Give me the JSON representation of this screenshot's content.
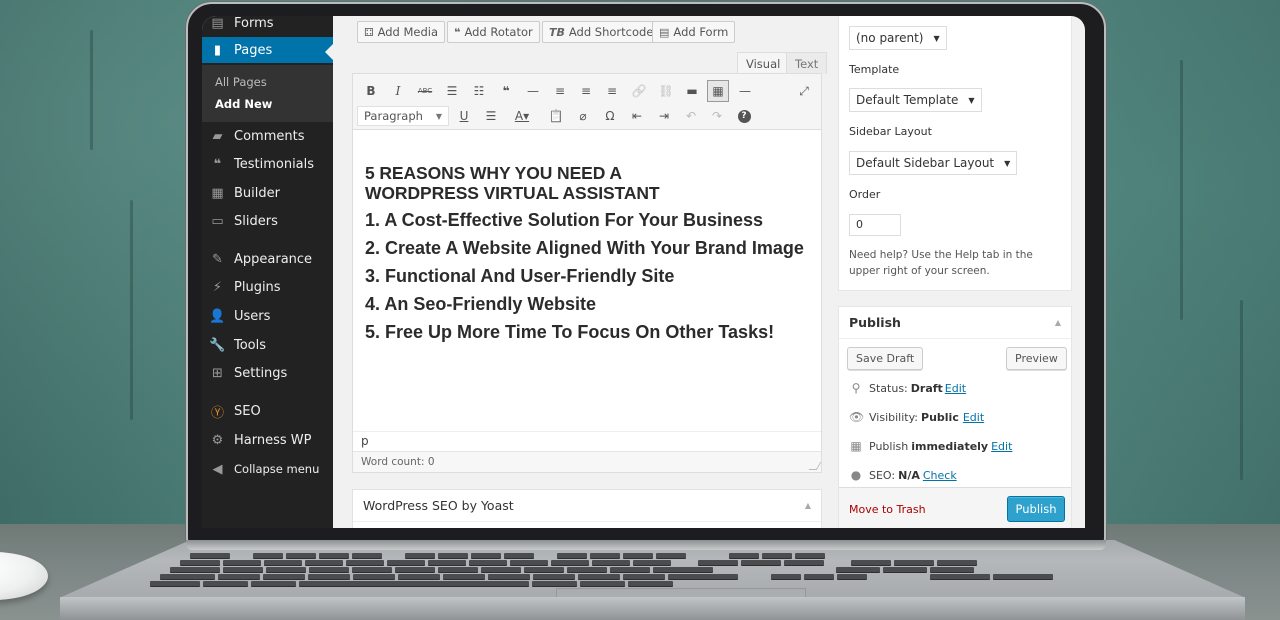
{
  "sidebar": {
    "items": [
      {
        "label": "Forms",
        "icon": "forms-icon"
      },
      {
        "label": "Pages",
        "icon": "pages-icon",
        "active": true
      },
      {
        "label": "Comments",
        "icon": "comments-icon"
      },
      {
        "label": "Testimonials",
        "icon": "quote-icon"
      },
      {
        "label": "Builder",
        "icon": "builder-icon"
      },
      {
        "label": "Sliders",
        "icon": "sliders-icon"
      },
      {
        "label": "Appearance",
        "icon": "paintbrush-icon"
      },
      {
        "label": "Plugins",
        "icon": "plug-icon"
      },
      {
        "label": "Users",
        "icon": "user-icon"
      },
      {
        "label": "Tools",
        "icon": "wrench-icon"
      },
      {
        "label": "Settings",
        "icon": "settings-icon"
      },
      {
        "label": "SEO",
        "icon": "yoast-icon"
      },
      {
        "label": "Harness WP",
        "icon": "gear-icon"
      }
    ],
    "submenu": [
      {
        "label": "All Pages"
      },
      {
        "label": "Add New",
        "current": true
      }
    ],
    "collapse_label": "Collapse menu"
  },
  "editor": {
    "media_buttons": [
      {
        "label": "Add Media",
        "icon": "add-media-icon",
        "glyph": "⚃"
      },
      {
        "label": "Add Rotator",
        "icon": "quote-icon",
        "glyph": "❝"
      },
      {
        "label": "Add Shortcode",
        "icon": "shortcode-icon",
        "glyph": "TB"
      },
      {
        "label": "Add Form",
        "icon": "form-icon",
        "glyph": "▤"
      }
    ],
    "tabs": {
      "visual": "Visual",
      "text": "Text"
    },
    "toolbar_row1": [
      {
        "name": "bold",
        "glyph": "B"
      },
      {
        "name": "italic",
        "glyph": "I"
      },
      {
        "name": "strikethrough",
        "glyph": "ABC"
      },
      {
        "name": "bullet-list",
        "glyph": "☰"
      },
      {
        "name": "numbered-list",
        "glyph": "☷"
      },
      {
        "name": "blockquote",
        "glyph": "❝"
      },
      {
        "name": "horizontal-line",
        "glyph": "—"
      },
      {
        "name": "align-left",
        "glyph": "≡"
      },
      {
        "name": "align-center",
        "glyph": "≡"
      },
      {
        "name": "align-right",
        "glyph": "≡"
      },
      {
        "name": "link",
        "glyph": "🔗",
        "disabled": true
      },
      {
        "name": "unlink",
        "glyph": "⛓",
        "disabled": true
      },
      {
        "name": "read-more",
        "glyph": "▬"
      },
      {
        "name": "toolbar-toggle",
        "glyph": "▦",
        "pressed": true
      },
      {
        "name": "dash",
        "glyph": "—"
      },
      {
        "name": "fullscreen",
        "glyph": "⤢"
      }
    ],
    "format_select": "Paragraph",
    "toolbar_row2": [
      {
        "name": "underline",
        "glyph": "U"
      },
      {
        "name": "justify",
        "glyph": "☰"
      },
      {
        "name": "text-color",
        "glyph": "A▾"
      },
      {
        "name": "paste-text",
        "glyph": "📋"
      },
      {
        "name": "clear-formatting",
        "glyph": "⌀"
      },
      {
        "name": "special-character",
        "glyph": "Ω"
      },
      {
        "name": "outdent",
        "glyph": "⇤"
      },
      {
        "name": "indent",
        "glyph": "⇥"
      },
      {
        "name": "undo",
        "glyph": "↶",
        "disabled": true
      },
      {
        "name": "redo",
        "glyph": "↷",
        "disabled": true
      },
      {
        "name": "help",
        "glyph": "?"
      }
    ],
    "content": {
      "title_line1": "5 REASONS WHY YOU NEED A",
      "title_line2": "WORDPRESS VIRTUAL ASSISTANT",
      "items": [
        "1. A Cost-Effective Solution For Your Business",
        "2. Create A Website Aligned With Your Brand Image",
        "3. Functional And User-Friendly Site",
        "4. An Seo-Friendly Website",
        "5. Free Up More Time To Focus On Other Tasks!"
      ]
    },
    "path": "p",
    "word_count": "Word count: 0"
  },
  "seo_box": {
    "title": "WordPress SEO by Yoast"
  },
  "page_attributes": {
    "parent_value": "(no parent)",
    "template_label": "Template",
    "template_value": "Default Template",
    "sidebar_layout_label": "Sidebar Layout",
    "sidebar_layout_value": "Default Sidebar Layout",
    "order_label": "Order",
    "order_value": "0",
    "help_text": "Need help? Use the Help tab in the upper right of your screen."
  },
  "publish": {
    "title": "Publish",
    "save_draft": "Save Draft",
    "preview": "Preview",
    "status_label": "Status:",
    "status_value": "Draft",
    "visibility_label": "Visibility:",
    "visibility_value": "Public",
    "publish_label": "Publish",
    "publish_value": "immediately",
    "seo_label": "SEO:",
    "seo_value": "N/A",
    "edit_link": "Edit",
    "check_link": "Check",
    "move_to_trash": "Move to Trash",
    "publish_button": "Publish"
  },
  "colors": {
    "admin_menu_bg": "#222222",
    "active_menu": "#0073aa",
    "primary_button": "#2ea2cc",
    "link": "#0073aa",
    "trash_link": "#aa0000"
  }
}
